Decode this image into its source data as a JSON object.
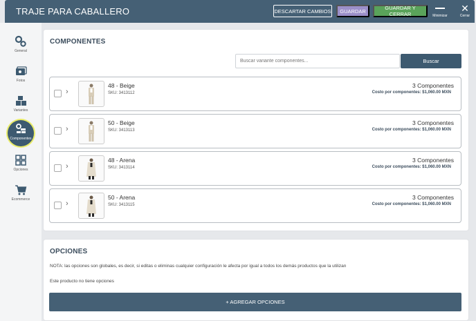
{
  "header": {
    "title": "TRAJE PARA CABALLERO",
    "discard_label": "DESCARTAR CAMBIOS",
    "save_label": "GUARDAR",
    "save_close_label": "GUARDAR Y CERRAR",
    "minimize_label": "Minimizar",
    "close_label": "Cerrar",
    "colors": {
      "header": "#456075",
      "save": "#9b8fc9",
      "save_close": "#5aa35a"
    }
  },
  "sidebar": {
    "items": [
      {
        "label": "General",
        "icon": "gears-icon"
      },
      {
        "label": "Fotos",
        "icon": "photos-icon"
      },
      {
        "label": "Variantes",
        "icon": "boxes-icon"
      },
      {
        "label": "Componentes",
        "icon": "components-icon",
        "active": true
      },
      {
        "label": "Opciones",
        "icon": "grid-icon"
      },
      {
        "label": "Ecommerce",
        "icon": "cart-icon"
      }
    ]
  },
  "components": {
    "title": "COMPONENTES",
    "search_placeholder": "Buscar variante componentes...",
    "search_button": "Buscar",
    "rows": [
      {
        "name": "48 - Beige",
        "sku": "SKU: 3413112",
        "count": "3 Componentes",
        "cost": "Costo por componentes: $1,060.00 MXN"
      },
      {
        "name": "50 - Beige",
        "sku": "SKU: 3413113",
        "count": "3 Componentes",
        "cost": "Costo por componentes: $1,060.00 MXN"
      },
      {
        "name": "48 - Arena",
        "sku": "SKU: 3413114",
        "count": "3 Componentes",
        "cost": "Costo por componentes: $1,060.00 MXN"
      },
      {
        "name": "50 - Arena",
        "sku": "SKU: 3413115",
        "count": "3 Componentes",
        "cost": "Costo por componentes: $1,060.00 MXN"
      }
    ]
  },
  "options": {
    "title": "OPCIONES",
    "note": "NOTA: las opciones son globales, es decir, si editas o eliminas cualquier configuración le afecta por igual a todos los demás productos que la utilizan",
    "empty_text": "Este producto no tiene opciones",
    "add_button": "+ AGREGAR OPCIONES"
  }
}
